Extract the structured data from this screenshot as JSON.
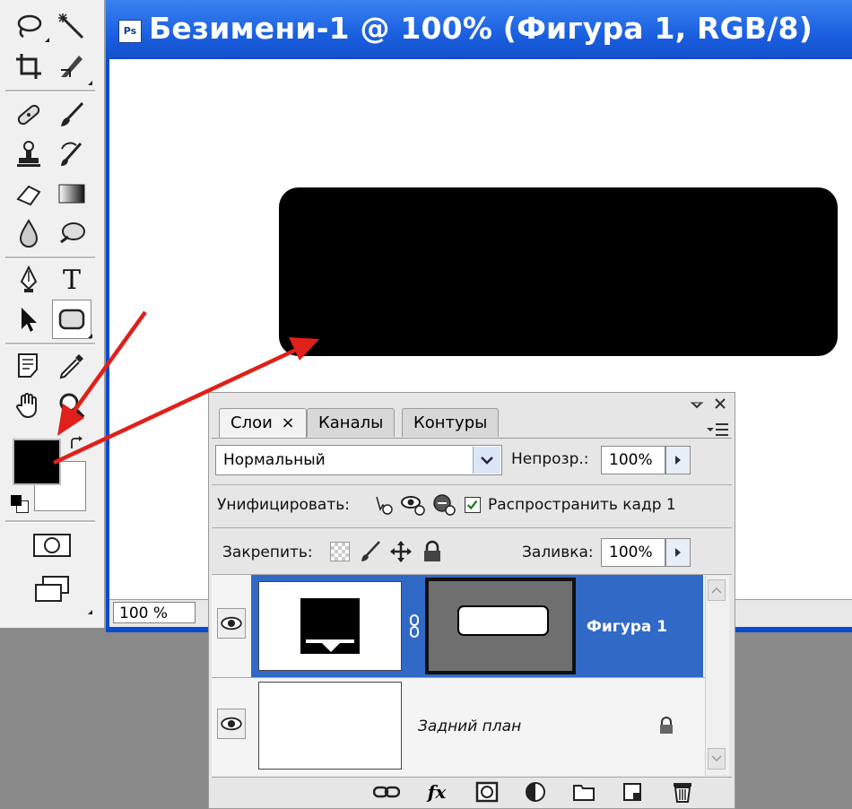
{
  "document": {
    "title": "Безимени-1 @ 100% (Фигура 1, RGB/8)",
    "ps_badge": "Ps",
    "zoom": "100 %"
  },
  "toolbox": {
    "tools": [
      "lasso-icon",
      "magic-wand-icon",
      "crop-icon",
      "slice-icon",
      "healing-brush-icon",
      "brush-icon",
      "clone-stamp-icon",
      "history-brush-icon",
      "eraser-icon",
      "gradient-icon",
      "blur-icon",
      "dodge-icon",
      "pen-icon",
      "type-icon",
      "path-selection-icon",
      "rounded-rectangle-icon",
      "notes-icon",
      "eyedropper-icon",
      "hand-icon",
      "zoom-icon"
    ],
    "type_tool_glyph": "T",
    "foreground_color": "#000000",
    "background_color": "#ffffff"
  },
  "layers_panel": {
    "tabs": [
      {
        "label": "Слои",
        "active": true,
        "closable": true
      },
      {
        "label": "Каналы",
        "active": false
      },
      {
        "label": "Контуры",
        "active": false
      }
    ],
    "close_glyph": "×",
    "blend_mode": "Нормальный",
    "opacity_label": "Непрозр.:",
    "opacity_value": "100%",
    "unify_label": "Унифицировать:",
    "propagate_label": "Распространить кадр 1",
    "propagate_checked": true,
    "lock_label": "Закрепить:",
    "fill_label": "Заливка:",
    "fill_value": "100%",
    "layers": [
      {
        "name": "Фигура 1",
        "selected": true,
        "visible": true,
        "type": "shape"
      },
      {
        "name": "Задний план",
        "selected": false,
        "visible": true,
        "locked": true,
        "type": "background"
      }
    ],
    "footer_icons": [
      "link-icon",
      "fx-icon",
      "mask-icon",
      "adjustment-icon",
      "folder-icon",
      "new-layer-icon",
      "trash-icon"
    ],
    "fx_glyph": "fx"
  },
  "colors": {
    "selection_blue": "#3169c6",
    "titlebar_blue": "#1a5fe0",
    "arrow_red": "#e0201a"
  }
}
